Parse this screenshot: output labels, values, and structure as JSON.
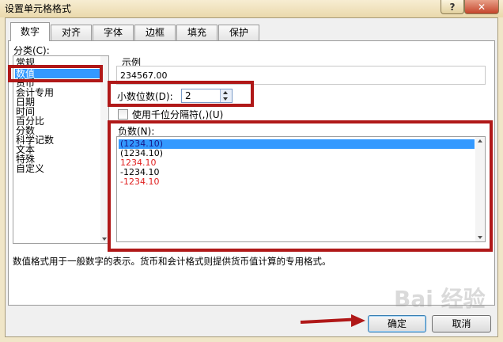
{
  "window": {
    "title": "设置单元格格式",
    "help_label": "?",
    "close_label": "✕"
  },
  "tabs": [
    {
      "label": "数字",
      "active": true
    },
    {
      "label": "对齐"
    },
    {
      "label": "字体"
    },
    {
      "label": "边框"
    },
    {
      "label": "填充"
    },
    {
      "label": "保护"
    }
  ],
  "category": {
    "label": "分类(C):",
    "items": [
      "常规",
      "数值",
      "货币",
      "会计专用",
      "日期",
      "时间",
      "百分比",
      "分数",
      "科学记数",
      "文本",
      "特殊",
      "自定义"
    ],
    "selected": "数值"
  },
  "sample": {
    "label": "示例",
    "value": "234567.00"
  },
  "decimal": {
    "label": "小数位数(D):",
    "value": "2"
  },
  "thousands": {
    "label": "使用千位分隔符(,)(U)",
    "checked": false
  },
  "negative": {
    "label": "负数(N):",
    "items": [
      "(1234.10)",
      "(1234.10)",
      "1234.10",
      "-1234.10",
      "-1234.10"
    ],
    "selected_index": 0
  },
  "description": "数值格式用于一般数字的表示。货币和会计格式则提供货币值计算的专用格式。",
  "buttons": {
    "ok": "确定",
    "cancel": "取消"
  },
  "watermark": "Bai 经验",
  "colors": {
    "selection": "#3399ff",
    "annotation": "#b01818",
    "negative_red": "#e02020"
  }
}
